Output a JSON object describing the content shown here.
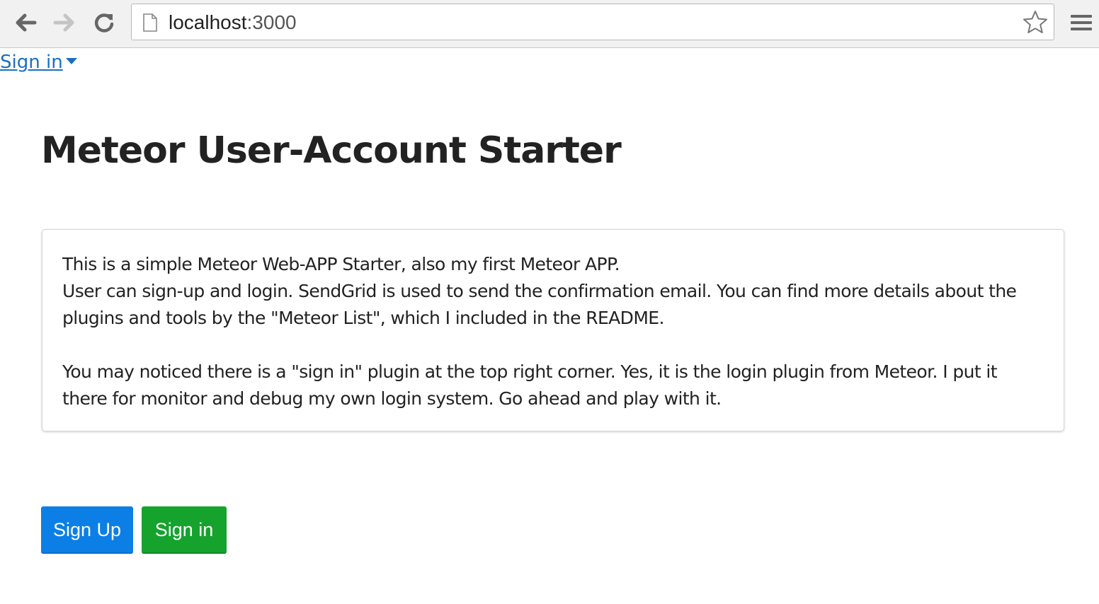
{
  "browser": {
    "url_host": "localhost",
    "url_port": ":3000",
    "icons": {
      "back": "back-arrow-icon",
      "forward": "forward-arrow-icon",
      "reload": "reload-icon",
      "page": "page-icon",
      "bookmark": "star-icon",
      "menu": "hamburger-menu-icon"
    }
  },
  "page": {
    "login_dropdown_label": "Sign in",
    "title": "Meteor User-Account Starter",
    "info": {
      "line1": "This is a simple Meteor Web-APP Starter, also my first Meteor APP.",
      "line2": "User can sign-up and login. SendGrid is used to send the confirmation email. You can find more details about the plugins and tools by the \"Meteor List\", which I included in the README.",
      "line3": "You may noticed there is a \"sign in\" plugin at the top right corner. Yes, it is the login plugin from Meteor. I put it there for monitor and debug my own login system. Go ahead and play with it."
    },
    "buttons": {
      "signup_label": "Sign Up",
      "signin_label": "Sign in"
    }
  },
  "colors": {
    "link": "#1a6fc4",
    "signup_button": "#0b7fe6",
    "signin_button": "#16a32d",
    "title_text": "#222222"
  }
}
